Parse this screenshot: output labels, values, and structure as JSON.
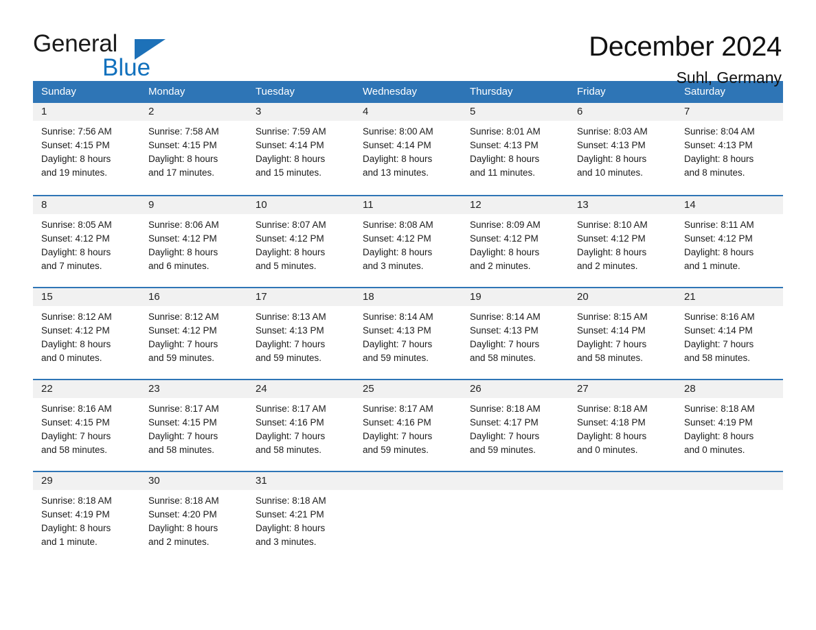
{
  "brand": {
    "name_part1": "General",
    "name_part2": "Blue",
    "colors": {
      "black": "#1a1a1a",
      "blue": "#1271bd",
      "triangle": "#1d71b8"
    }
  },
  "header": {
    "title": "December 2024",
    "subtitle": "Suhl, Germany"
  },
  "theme": {
    "header_blue": "#2e75b6",
    "daynum_band": "#f1f1f1",
    "text": "#1a1a1a"
  },
  "weekdays": [
    "Sunday",
    "Monday",
    "Tuesday",
    "Wednesday",
    "Thursday",
    "Friday",
    "Saturday"
  ],
  "weeks": [
    [
      {
        "day": "1",
        "sunrise": "Sunrise: 7:56 AM",
        "sunset": "Sunset: 4:15 PM",
        "daylight1": "Daylight: 8 hours",
        "daylight2": "and 19 minutes."
      },
      {
        "day": "2",
        "sunrise": "Sunrise: 7:58 AM",
        "sunset": "Sunset: 4:15 PM",
        "daylight1": "Daylight: 8 hours",
        "daylight2": "and 17 minutes."
      },
      {
        "day": "3",
        "sunrise": "Sunrise: 7:59 AM",
        "sunset": "Sunset: 4:14 PM",
        "daylight1": "Daylight: 8 hours",
        "daylight2": "and 15 minutes."
      },
      {
        "day": "4",
        "sunrise": "Sunrise: 8:00 AM",
        "sunset": "Sunset: 4:14 PM",
        "daylight1": "Daylight: 8 hours",
        "daylight2": "and 13 minutes."
      },
      {
        "day": "5",
        "sunrise": "Sunrise: 8:01 AM",
        "sunset": "Sunset: 4:13 PM",
        "daylight1": "Daylight: 8 hours",
        "daylight2": "and 11 minutes."
      },
      {
        "day": "6",
        "sunrise": "Sunrise: 8:03 AM",
        "sunset": "Sunset: 4:13 PM",
        "daylight1": "Daylight: 8 hours",
        "daylight2": "and 10 minutes."
      },
      {
        "day": "7",
        "sunrise": "Sunrise: 8:04 AM",
        "sunset": "Sunset: 4:13 PM",
        "daylight1": "Daylight: 8 hours",
        "daylight2": "and 8 minutes."
      }
    ],
    [
      {
        "day": "8",
        "sunrise": "Sunrise: 8:05 AM",
        "sunset": "Sunset: 4:12 PM",
        "daylight1": "Daylight: 8 hours",
        "daylight2": "and 7 minutes."
      },
      {
        "day": "9",
        "sunrise": "Sunrise: 8:06 AM",
        "sunset": "Sunset: 4:12 PM",
        "daylight1": "Daylight: 8 hours",
        "daylight2": "and 6 minutes."
      },
      {
        "day": "10",
        "sunrise": "Sunrise: 8:07 AM",
        "sunset": "Sunset: 4:12 PM",
        "daylight1": "Daylight: 8 hours",
        "daylight2": "and 5 minutes."
      },
      {
        "day": "11",
        "sunrise": "Sunrise: 8:08 AM",
        "sunset": "Sunset: 4:12 PM",
        "daylight1": "Daylight: 8 hours",
        "daylight2": "and 3 minutes."
      },
      {
        "day": "12",
        "sunrise": "Sunrise: 8:09 AM",
        "sunset": "Sunset: 4:12 PM",
        "daylight1": "Daylight: 8 hours",
        "daylight2": "and 2 minutes."
      },
      {
        "day": "13",
        "sunrise": "Sunrise: 8:10 AM",
        "sunset": "Sunset: 4:12 PM",
        "daylight1": "Daylight: 8 hours",
        "daylight2": "and 2 minutes."
      },
      {
        "day": "14",
        "sunrise": "Sunrise: 8:11 AM",
        "sunset": "Sunset: 4:12 PM",
        "daylight1": "Daylight: 8 hours",
        "daylight2": "and 1 minute."
      }
    ],
    [
      {
        "day": "15",
        "sunrise": "Sunrise: 8:12 AM",
        "sunset": "Sunset: 4:12 PM",
        "daylight1": "Daylight: 8 hours",
        "daylight2": "and 0 minutes."
      },
      {
        "day": "16",
        "sunrise": "Sunrise: 8:12 AM",
        "sunset": "Sunset: 4:12 PM",
        "daylight1": "Daylight: 7 hours",
        "daylight2": "and 59 minutes."
      },
      {
        "day": "17",
        "sunrise": "Sunrise: 8:13 AM",
        "sunset": "Sunset: 4:13 PM",
        "daylight1": "Daylight: 7 hours",
        "daylight2": "and 59 minutes."
      },
      {
        "day": "18",
        "sunrise": "Sunrise: 8:14 AM",
        "sunset": "Sunset: 4:13 PM",
        "daylight1": "Daylight: 7 hours",
        "daylight2": "and 59 minutes."
      },
      {
        "day": "19",
        "sunrise": "Sunrise: 8:14 AM",
        "sunset": "Sunset: 4:13 PM",
        "daylight1": "Daylight: 7 hours",
        "daylight2": "and 58 minutes."
      },
      {
        "day": "20",
        "sunrise": "Sunrise: 8:15 AM",
        "sunset": "Sunset: 4:14 PM",
        "daylight1": "Daylight: 7 hours",
        "daylight2": "and 58 minutes."
      },
      {
        "day": "21",
        "sunrise": "Sunrise: 8:16 AM",
        "sunset": "Sunset: 4:14 PM",
        "daylight1": "Daylight: 7 hours",
        "daylight2": "and 58 minutes."
      }
    ],
    [
      {
        "day": "22",
        "sunrise": "Sunrise: 8:16 AM",
        "sunset": "Sunset: 4:15 PM",
        "daylight1": "Daylight: 7 hours",
        "daylight2": "and 58 minutes."
      },
      {
        "day": "23",
        "sunrise": "Sunrise: 8:17 AM",
        "sunset": "Sunset: 4:15 PM",
        "daylight1": "Daylight: 7 hours",
        "daylight2": "and 58 minutes."
      },
      {
        "day": "24",
        "sunrise": "Sunrise: 8:17 AM",
        "sunset": "Sunset: 4:16 PM",
        "daylight1": "Daylight: 7 hours",
        "daylight2": "and 58 minutes."
      },
      {
        "day": "25",
        "sunrise": "Sunrise: 8:17 AM",
        "sunset": "Sunset: 4:16 PM",
        "daylight1": "Daylight: 7 hours",
        "daylight2": "and 59 minutes."
      },
      {
        "day": "26",
        "sunrise": "Sunrise: 8:18 AM",
        "sunset": "Sunset: 4:17 PM",
        "daylight1": "Daylight: 7 hours",
        "daylight2": "and 59 minutes."
      },
      {
        "day": "27",
        "sunrise": "Sunrise: 8:18 AM",
        "sunset": "Sunset: 4:18 PM",
        "daylight1": "Daylight: 8 hours",
        "daylight2": "and 0 minutes."
      },
      {
        "day": "28",
        "sunrise": "Sunrise: 8:18 AM",
        "sunset": "Sunset: 4:19 PM",
        "daylight1": "Daylight: 8 hours",
        "daylight2": "and 0 minutes."
      }
    ],
    [
      {
        "day": "29",
        "sunrise": "Sunrise: 8:18 AM",
        "sunset": "Sunset: 4:19 PM",
        "daylight1": "Daylight: 8 hours",
        "daylight2": "and 1 minute."
      },
      {
        "day": "30",
        "sunrise": "Sunrise: 8:18 AM",
        "sunset": "Sunset: 4:20 PM",
        "daylight1": "Daylight: 8 hours",
        "daylight2": "and 2 minutes."
      },
      {
        "day": "31",
        "sunrise": "Sunrise: 8:18 AM",
        "sunset": "Sunset: 4:21 PM",
        "daylight1": "Daylight: 8 hours",
        "daylight2": "and 3 minutes."
      },
      {
        "day": "",
        "sunrise": "",
        "sunset": "",
        "daylight1": "",
        "daylight2": ""
      },
      {
        "day": "",
        "sunrise": "",
        "sunset": "",
        "daylight1": "",
        "daylight2": ""
      },
      {
        "day": "",
        "sunrise": "",
        "sunset": "",
        "daylight1": "",
        "daylight2": ""
      },
      {
        "day": "",
        "sunrise": "",
        "sunset": "",
        "daylight1": "",
        "daylight2": ""
      }
    ]
  ]
}
